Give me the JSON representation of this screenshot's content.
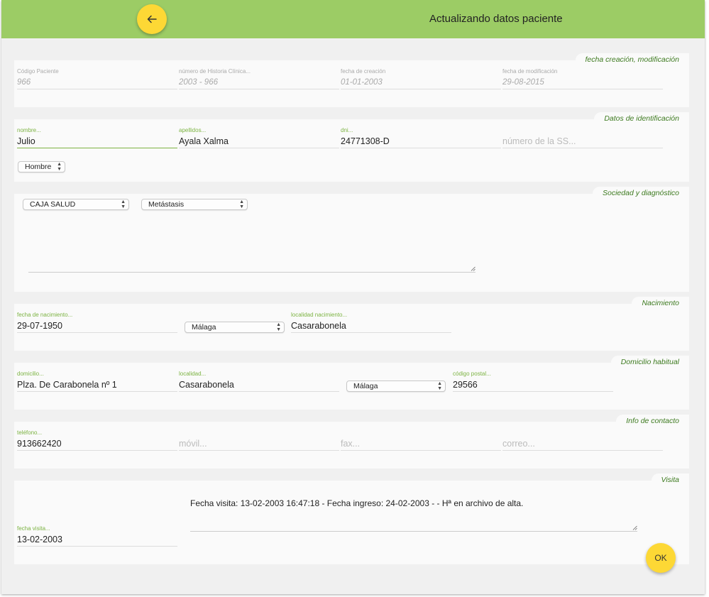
{
  "header": {
    "title": "Actualizando datos paciente",
    "back_icon": "arrow-left-icon"
  },
  "colors": {
    "topbar": "#9ccc65",
    "accent": "#7cb342",
    "fab": "#fdd835",
    "section_tag": "#3d7a1f"
  },
  "sections": {
    "fechas": {
      "tag": "fecha creación, modificación",
      "codigo_label": "Código Paciente",
      "codigo_value": "966",
      "historia_label": "número de Historia Clínica...",
      "historia_value": "2003 - 966",
      "creacion_label": "fecha de creación",
      "creacion_value": "01-01-2003",
      "modificacion_label": "fecha de modificación",
      "modificacion_value": "29-08-2015"
    },
    "identificacion": {
      "tag": "Datos de identificación",
      "nombre_label": "nombre...",
      "nombre_value": "Julio",
      "apellidos_label": "apellidos...",
      "apellidos_value": "Ayala Xalma",
      "dni_label": "dni...",
      "dni_value": "24771308-D",
      "ss_placeholder": "número de la SS...",
      "sexo_value": "Hombre"
    },
    "sociedad": {
      "tag": "Sociedad y diagnóstico",
      "sociedad_value": "CAJA SALUD",
      "diagnostico_value": "Metástasis"
    },
    "nacimiento": {
      "tag": "Nacimiento",
      "fecha_label": "fecha de nacimiento...",
      "fecha_value": "29-07-1950",
      "provincia_value": "Málaga",
      "localidad_label": "localidad nacimiento...",
      "localidad_value": "Casarabonela"
    },
    "domicilio": {
      "tag": "Domicilio habitual",
      "domicilio_label": "domicilio...",
      "domicilio_value": "Plza. De Carabonela  nº  1",
      "localidad_label": "localidad...",
      "localidad_value": "Casarabonela",
      "provincia_value": "Málaga",
      "cp_label": "código postal...",
      "cp_value": "29566"
    },
    "contacto": {
      "tag": "Info de contacto",
      "telefono_label": "teléfono...",
      "telefono_value": "913662420",
      "movil_placeholder": "móvil...",
      "fax_placeholder": "fax...",
      "correo_placeholder": "correo..."
    },
    "visita": {
      "tag": "Visita",
      "texto": "Fecha visita: 13-02-2003 16:47:18 - Fecha ingreso: 24-02-2003 -  - Hª en archivo de alta.",
      "fecha_label": "fecha visita...",
      "fecha_value": "13-02-2003"
    }
  },
  "ok_label": "OK"
}
